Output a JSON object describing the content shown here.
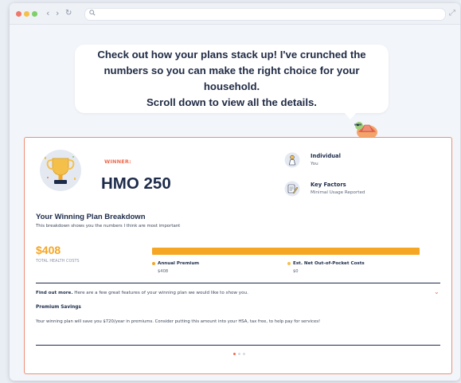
{
  "bubble": {
    "line1": "Check out how your plans stack up! I've crunched the",
    "line2": "numbers so you can make the right choice for your household.",
    "line3": "Scroll down to view all the details."
  },
  "winner": {
    "label": "WINNER:",
    "plan_name": "HMO 250"
  },
  "info": [
    {
      "title": "Individual",
      "subtitle": "You",
      "icon": "person-icon"
    },
    {
      "title": "Key Factors",
      "subtitle": "Minimal Usage Reported",
      "icon": "clipboard-pen-icon"
    }
  ],
  "breakdown": {
    "title": "Your Winning Plan Breakdown",
    "subtitle": "This breakdown shows you the numbers I think are most important",
    "total_amount": "$408",
    "total_label": "TOTAL HEALTH COSTS",
    "premium_fraction": 1.0,
    "legend": [
      {
        "label": "Annual Premium",
        "value": "$408",
        "color": "#f5a623"
      },
      {
        "label": "Est. Net Out-of-Pocket Costs",
        "value": "$0",
        "color": "#f5c04a"
      }
    ]
  },
  "features": {
    "intro_bold": "Find out more.",
    "intro_rest": " Here are a few great features of your winning plan we would like to show you.",
    "title": "Premium Savings",
    "description": "Your winning plan will save you $720/year in premiums. Consider putting this amount into your HSA, tax free, to help pay for services!"
  },
  "colors": {
    "accent": "#ef6a4c",
    "bar": "#f5a623",
    "navy": "#1d2b4a"
  },
  "pager": {
    "count": 3,
    "active": 0
  }
}
